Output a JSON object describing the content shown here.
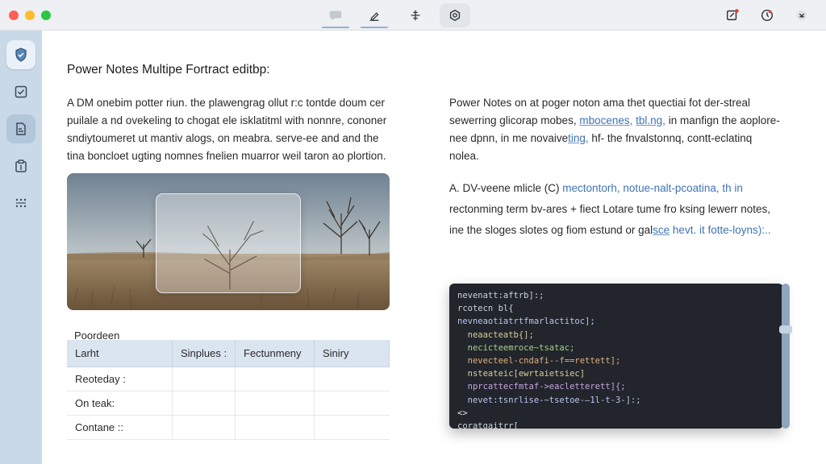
{
  "colors": {
    "accent": "#3f73b5",
    "sidebar": "#c9d9e8",
    "code_bg": "#22252b"
  },
  "toolbar": {
    "icons": [
      "comment-icon",
      "pen-tool-icon",
      "move-icon",
      "settings-icon",
      "new-note-icon",
      "history-icon",
      "extensions-icon"
    ]
  },
  "sidebar": {
    "items": [
      {
        "icon": "shield-icon",
        "state": "selected"
      },
      {
        "icon": "checklist-icon",
        "state": "normal"
      },
      {
        "icon": "note-icon",
        "state": "hover"
      },
      {
        "icon": "clipboard-icon",
        "state": "normal"
      },
      {
        "icon": "grid-dots-icon",
        "state": "normal"
      }
    ]
  },
  "document": {
    "title": "Power Notes Multipe Fortract editbp:",
    "left_paragraph": "A DM onebim potter riun. the plawengrag ollut r:c tontde doum cer puilale a nd ovekeling to chogat ele isklatitml with nonnre, cononer sndiytoumeret ut mantiv alogs, on meabra. serve-ee and and the tina boncloet ugting nomnes fnelien muarror weil taron ao plortion.",
    "right_paragraph_1": {
      "part1": "Power Notes on at poger noton ama thet quectiai fot der-streal sewerring glicorap mobes,",
      "link1": "mbocenes,",
      "part2": " ",
      "link2": "tbl.ng,",
      "part3": " in manfign the aoplore-nee dpnn, in me novaive",
      "link3": "ting,",
      "part4": " hf- the fnvalstonnq, contt-eclatinq nolea."
    },
    "right_paragraph_2": {
      "part1": "A. DV-veene mlicle (C)",
      "blue1": " mectontorh, notue-nalt-pcoatina, th in",
      "part2": " rectonming term bv-ares + fiect Lotare tume fro ksing lewerr notes, ine the sloges slotes og fiom estund or gal",
      "link1": "sce",
      "blue2": " hevt. it fotte-loyns):.."
    }
  },
  "table": {
    "caption": "Poordeen",
    "columns": [
      "Larht",
      "Sinplues :",
      "Fectunmeny",
      "Siniry"
    ],
    "rows": [
      [
        "Reoteday :",
        "",
        "",
        ""
      ],
      [
        "On teak:",
        "",
        "",
        ""
      ],
      [
        "Contane ::",
        "",
        "",
        ""
      ]
    ]
  },
  "code": {
    "lines": [
      "nevenatt:aftrb]:;",
      "rcotecn bl{",
      "nevneaotiatrtfmarlactitoc];",
      "  neaacteatb{];",
      "  necicteemroce~tsatac;",
      "  nevecteel-cndafi--f==rettett];",
      "  nsteateic[ewrtaietsiec]",
      "  nprcattecfmtaf->eacletterett]{;",
      "  nevet:tsnrlise-~tsetoe-—1l-t-3-]:;",
      "<>",
      "coratgaitrr["
    ]
  }
}
